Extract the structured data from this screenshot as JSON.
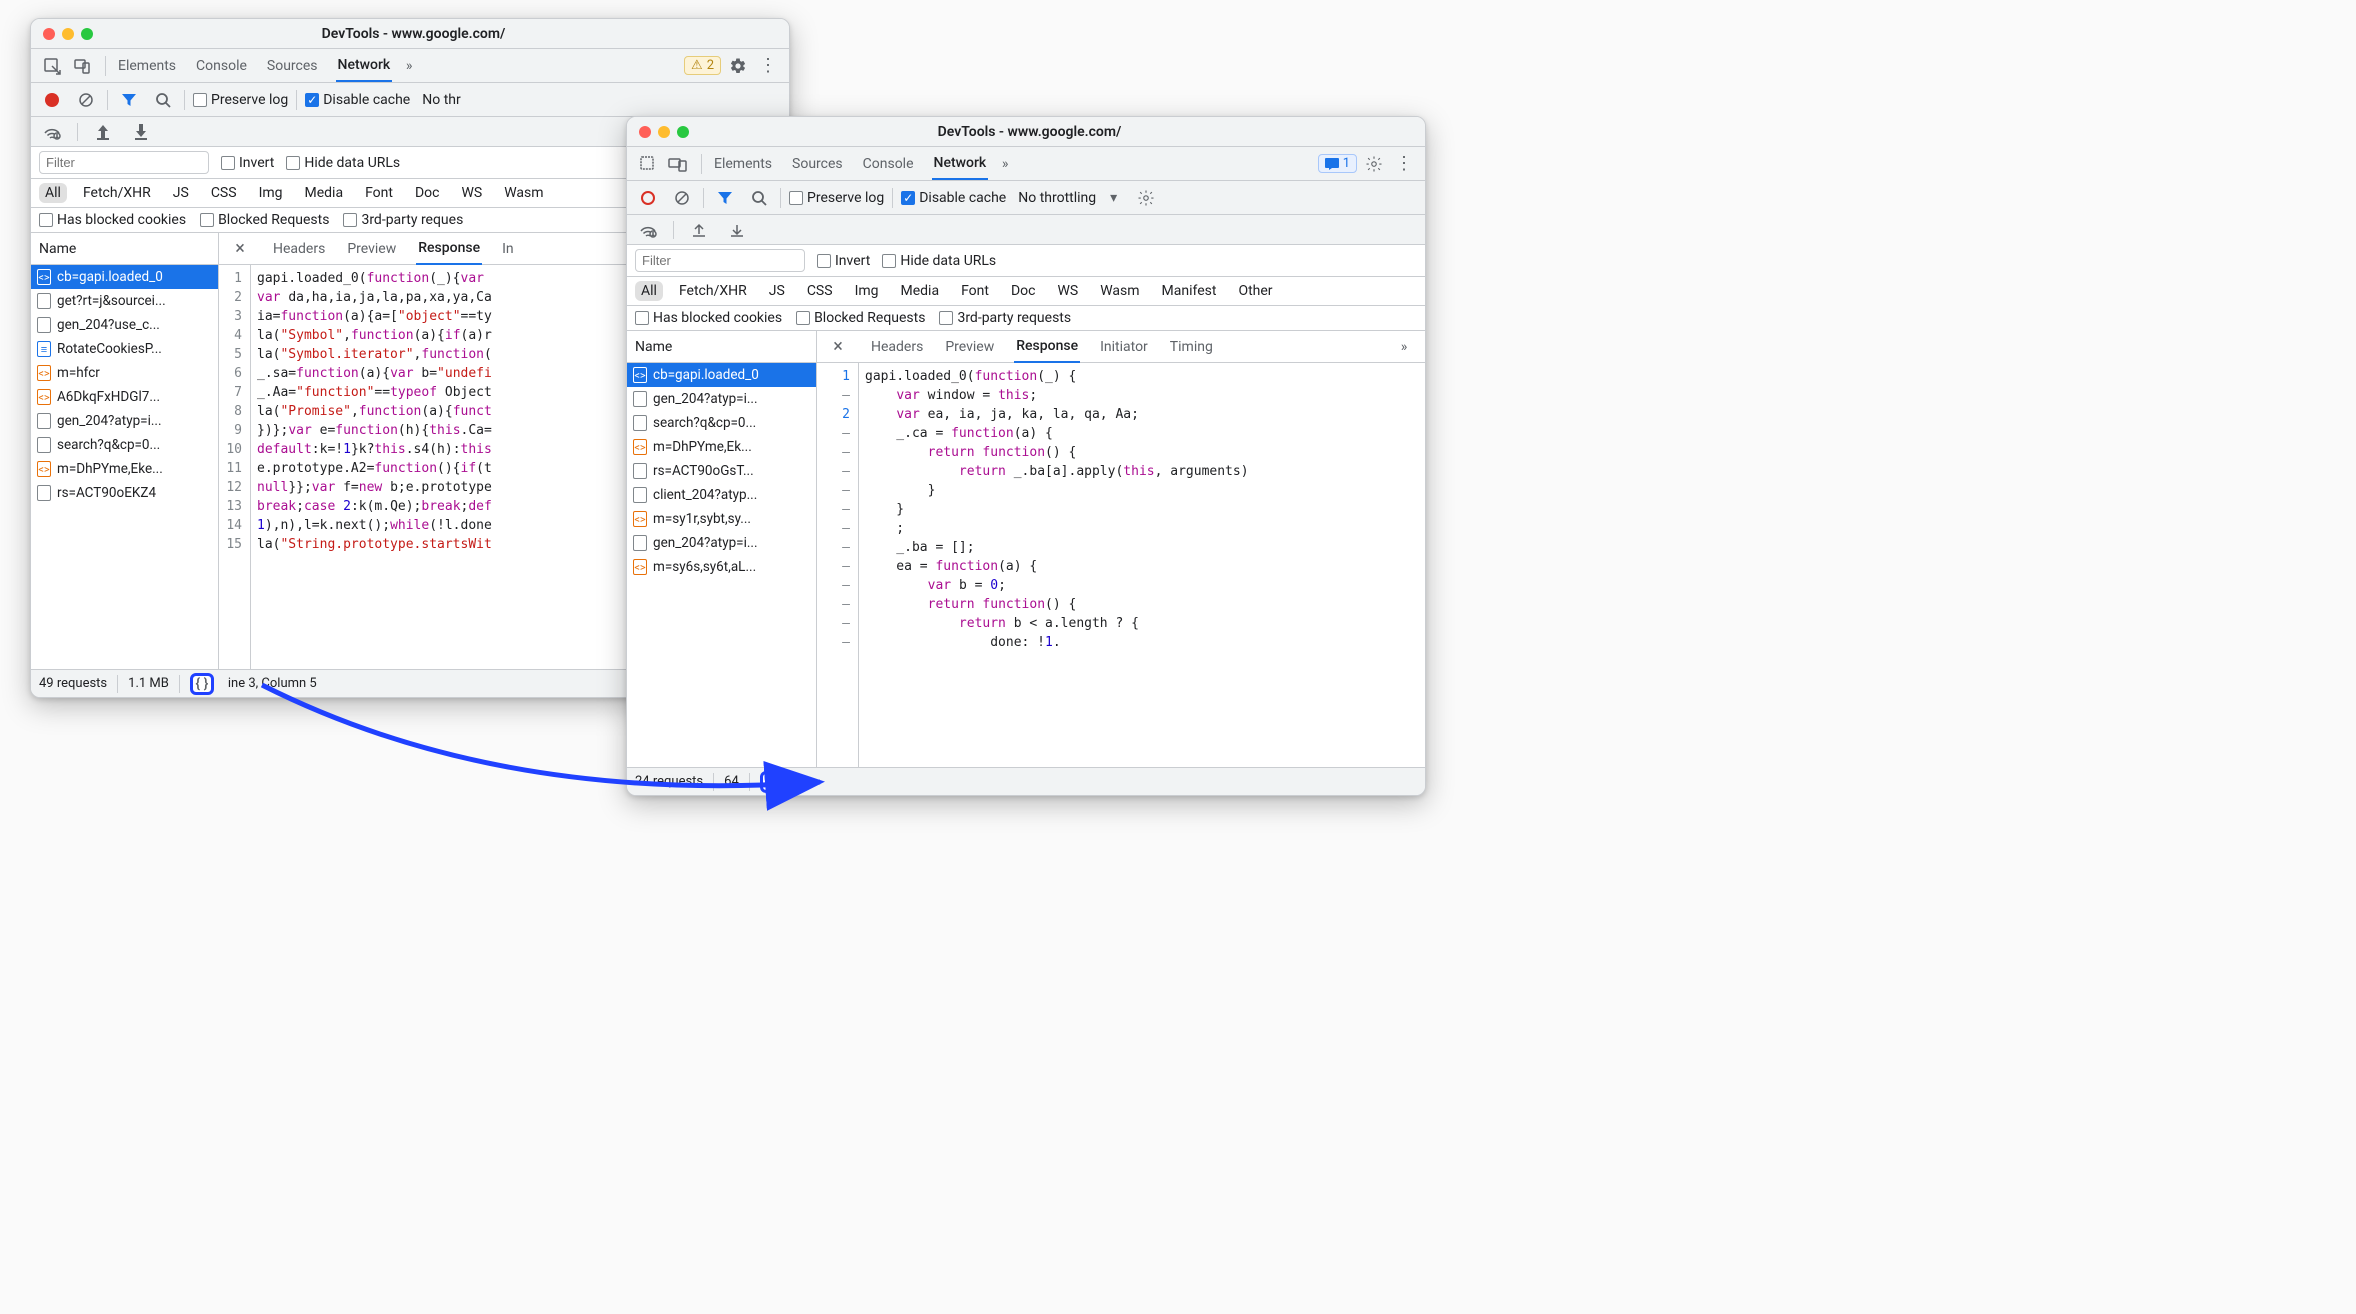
{
  "win1": {
    "title": "DevTools - www.google.com/",
    "tabs": [
      "Elements",
      "Console",
      "Sources",
      "Network"
    ],
    "active_tab": 3,
    "warn_count": "2",
    "preserve_log": "Preserve log",
    "disable_cache": "Disable cache",
    "throttling": "No thr",
    "filter_placeholder": "Filter",
    "invert": "Invert",
    "hide_data_urls": "Hide data URLs",
    "type_filters": [
      "All",
      "Fetch/XHR",
      "JS",
      "CSS",
      "Img",
      "Media",
      "Font",
      "Doc",
      "WS",
      "Wasm"
    ],
    "active_type": 0,
    "opt_blocked_cookies": "Has blocked cookies",
    "opt_blocked_requests": "Blocked Requests",
    "opt_third_party": "3rd-party reques",
    "name_header": "Name",
    "detail_tabs": [
      "Headers",
      "Preview",
      "Response",
      "In"
    ],
    "active_detail": 2,
    "files": [
      {
        "icon": "orange",
        "label": "cb=gapi.loaded_0",
        "selected": true
      },
      {
        "icon": "gray",
        "label": "get?rt=j&sourcei..."
      },
      {
        "icon": "gray",
        "label": "gen_204?use_c..."
      },
      {
        "icon": "blue",
        "label": "RotateCookiesP..."
      },
      {
        "icon": "orange",
        "label": "m=hfcr"
      },
      {
        "icon": "orange",
        "label": "A6DkqFxHDGl7..."
      },
      {
        "icon": "gray",
        "label": "gen_204?atyp=i..."
      },
      {
        "icon": "gray",
        "label": "search?q&cp=0..."
      },
      {
        "icon": "orange",
        "label": "m=DhPYme,Eke..."
      },
      {
        "icon": "gray",
        "label": "rs=ACT90oEKZ4"
      }
    ],
    "gutter": [
      "1",
      "2",
      "3",
      "4",
      "5",
      "6",
      "7",
      "8",
      "9",
      "10",
      "11",
      "12",
      "13",
      "14",
      "15"
    ],
    "code_lines": [
      [
        {
          "t": "gapi.loaded_0("
        },
        {
          "t": "function",
          "c": "c-kw"
        },
        {
          "t": "(_){"
        },
        {
          "t": "var ",
          "c": "c-kw"
        }
      ],
      [
        {
          "t": "var ",
          "c": "c-kw"
        },
        {
          "t": "da,ha,ia,ja,la,pa,xa,ya,Ca"
        }
      ],
      [
        {
          "t": "ia="
        },
        {
          "t": "function",
          "c": "c-kw"
        },
        {
          "t": "(a){a=["
        },
        {
          "t": "\"object\"",
          "c": "c-str"
        },
        {
          "t": "==ty"
        }
      ],
      [
        {
          "t": "la("
        },
        {
          "t": "\"Symbol\"",
          "c": "c-str"
        },
        {
          "t": ","
        },
        {
          "t": "function",
          "c": "c-kw"
        },
        {
          "t": "(a){"
        },
        {
          "t": "if",
          "c": "c-kw"
        },
        {
          "t": "(a)r"
        }
      ],
      [
        {
          "t": "la("
        },
        {
          "t": "\"Symbol.iterator\"",
          "c": "c-str"
        },
        {
          "t": ","
        },
        {
          "t": "function",
          "c": "c-kw"
        },
        {
          "t": "("
        }
      ],
      [
        {
          "t": "_.sa="
        },
        {
          "t": "function",
          "c": "c-kw"
        },
        {
          "t": "(a){"
        },
        {
          "t": "var ",
          "c": "c-kw"
        },
        {
          "t": "b="
        },
        {
          "t": "\"undefi",
          "c": "c-str"
        }
      ],
      [
        {
          "t": "_.Aa="
        },
        {
          "t": "\"function\"",
          "c": "c-str"
        },
        {
          "t": "=="
        },
        {
          "t": "typeof ",
          "c": "c-kw"
        },
        {
          "t": "Object"
        }
      ],
      [
        {
          "t": "la("
        },
        {
          "t": "\"Promise\"",
          "c": "c-str"
        },
        {
          "t": ","
        },
        {
          "t": "function",
          "c": "c-kw"
        },
        {
          "t": "(a){"
        },
        {
          "t": "funct",
          "c": "c-kw"
        }
      ],
      [
        {
          "t": "})};"
        },
        {
          "t": "var ",
          "c": "c-kw"
        },
        {
          "t": "e="
        },
        {
          "t": "function",
          "c": "c-kw"
        },
        {
          "t": "(h){"
        },
        {
          "t": "this",
          "c": "c-this"
        },
        {
          "t": ".Ca="
        }
      ],
      [
        {
          "t": "default",
          "c": "c-kw"
        },
        {
          "t": ":k=!"
        },
        {
          "t": "1",
          "c": "c-num"
        },
        {
          "t": "}k?"
        },
        {
          "t": "this",
          "c": "c-this"
        },
        {
          "t": ".s4(h):"
        },
        {
          "t": "this",
          "c": "c-this"
        }
      ],
      [
        {
          "t": "e.prototype.A2="
        },
        {
          "t": "function",
          "c": "c-kw"
        },
        {
          "t": "(){"
        },
        {
          "t": "if",
          "c": "c-kw"
        },
        {
          "t": "(t"
        }
      ],
      [
        {
          "t": "null",
          "c": "c-kw"
        },
        {
          "t": "}};"
        },
        {
          "t": "var ",
          "c": "c-kw"
        },
        {
          "t": "f="
        },
        {
          "t": "new ",
          "c": "c-kw"
        },
        {
          "t": "b;e.prototype"
        }
      ],
      [
        {
          "t": "break",
          "c": "c-kw"
        },
        {
          "t": ";"
        },
        {
          "t": "case ",
          "c": "c-kw"
        },
        {
          "t": "2",
          "c": "c-num"
        },
        {
          "t": ":k(m.Qe);"
        },
        {
          "t": "break",
          "c": "c-kw"
        },
        {
          "t": ";"
        },
        {
          "t": "def",
          "c": "c-kw"
        }
      ],
      [
        {
          "t": "1",
          "c": "c-num"
        },
        {
          "t": "),n),l=k.next();"
        },
        {
          "t": "while",
          "c": "c-kw"
        },
        {
          "t": "(!l.done"
        }
      ],
      [
        {
          "t": "la("
        },
        {
          "t": "\"String.prototype.startsWit",
          "c": "c-str"
        }
      ]
    ],
    "footer_requests": "49 requests",
    "footer_size": "1.1 MB",
    "footer_pos": "ine 3, Column 5"
  },
  "win2": {
    "title": "DevTools - www.google.com/",
    "tabs": [
      "Elements",
      "Sources",
      "Console",
      "Network"
    ],
    "active_tab": 3,
    "msg_count": "1",
    "preserve_log": "Preserve log",
    "disable_cache": "Disable cache",
    "throttling": "No throttling",
    "filter_placeholder": "Filter",
    "invert": "Invert",
    "hide_data_urls": "Hide data URLs",
    "type_filters": [
      "All",
      "Fetch/XHR",
      "JS",
      "CSS",
      "Img",
      "Media",
      "Font",
      "Doc",
      "WS",
      "Wasm",
      "Manifest",
      "Other"
    ],
    "active_type": 0,
    "opt_blocked_cookies": "Has blocked cookies",
    "opt_blocked_requests": "Blocked Requests",
    "opt_third_party": "3rd-party requests",
    "name_header": "Name",
    "detail_tabs": [
      "Headers",
      "Preview",
      "Response",
      "Initiator",
      "Timing"
    ],
    "active_detail": 2,
    "files": [
      {
        "icon": "orange",
        "label": "cb=gapi.loaded_0",
        "selected": true
      },
      {
        "icon": "gray",
        "label": "gen_204?atyp=i..."
      },
      {
        "icon": "gray",
        "label": "search?q&cp=0..."
      },
      {
        "icon": "orange",
        "label": "m=DhPYme,Ek..."
      },
      {
        "icon": "gray",
        "label": "rs=ACT90oGsT..."
      },
      {
        "icon": "gray",
        "label": "client_204?atyp..."
      },
      {
        "icon": "orange",
        "label": "m=sy1r,sybt,sy..."
      },
      {
        "icon": "gray",
        "label": "gen_204?atyp=i..."
      },
      {
        "icon": "orange",
        "label": "m=sy6s,sy6t,aL..."
      }
    ],
    "gutter": [
      "1",
      "–",
      "2",
      "–",
      "–",
      "–",
      "–",
      "–",
      "–",
      "–",
      "–",
      "–",
      "–",
      "–",
      "–"
    ],
    "code_lines": [
      [
        {
          "t": "gapi.loaded_0("
        },
        {
          "t": "function",
          "c": "c-kw"
        },
        {
          "t": "(_) {"
        }
      ],
      [
        {
          "t": "    "
        },
        {
          "t": "var ",
          "c": "c-kw"
        },
        {
          "t": "window = "
        },
        {
          "t": "this",
          "c": "c-this"
        },
        {
          "t": ";"
        }
      ],
      [
        {
          "t": "    "
        },
        {
          "t": "var ",
          "c": "c-kw"
        },
        {
          "t": "ea, ia, ja, ka, la, qa, Aa;"
        }
      ],
      [
        {
          "t": "    _.ca = "
        },
        {
          "t": "function",
          "c": "c-kw"
        },
        {
          "t": "(a) {"
        }
      ],
      [
        {
          "t": "        "
        },
        {
          "t": "return function",
          "c": "c-kw"
        },
        {
          "t": "() {"
        }
      ],
      [
        {
          "t": "            "
        },
        {
          "t": "return ",
          "c": "c-kw"
        },
        {
          "t": "_.ba[a].apply("
        },
        {
          "t": "this",
          "c": "c-this"
        },
        {
          "t": ", arguments)"
        }
      ],
      [
        {
          "t": "        }"
        }
      ],
      [
        {
          "t": "    }"
        }
      ],
      [
        {
          "t": "    ;"
        }
      ],
      [
        {
          "t": "    _.ba = [];"
        }
      ],
      [
        {
          "t": "    ea = "
        },
        {
          "t": "function",
          "c": "c-kw"
        },
        {
          "t": "(a) {"
        }
      ],
      [
        {
          "t": "        "
        },
        {
          "t": "var ",
          "c": "c-kw"
        },
        {
          "t": "b = "
        },
        {
          "t": "0",
          "c": "c-num"
        },
        {
          "t": ";"
        }
      ],
      [
        {
          "t": "        "
        },
        {
          "t": "return function",
          "c": "c-kw"
        },
        {
          "t": "() {"
        }
      ],
      [
        {
          "t": "            "
        },
        {
          "t": "return ",
          "c": "c-kw"
        },
        {
          "t": "b < a.length ? {"
        }
      ],
      [
        {
          "t": "                done: !"
        },
        {
          "t": "1",
          "c": "c-num"
        },
        {
          "t": "."
        }
      ]
    ],
    "footer_requests": "24 requests",
    "footer_size": "64"
  },
  "icons": {
    "inspect": "⬚",
    "devices": "▭",
    "more_tabs": "»",
    "gear": "⚙",
    "kebab": "⋮",
    "stop": "⊘",
    "funnel": "▼",
    "search": "🔍",
    "wifi": "≋",
    "upload": "↥",
    "download": "↧",
    "close": "×",
    "chevron_down": "▾",
    "pp": "{ }",
    "msg": "▤"
  }
}
